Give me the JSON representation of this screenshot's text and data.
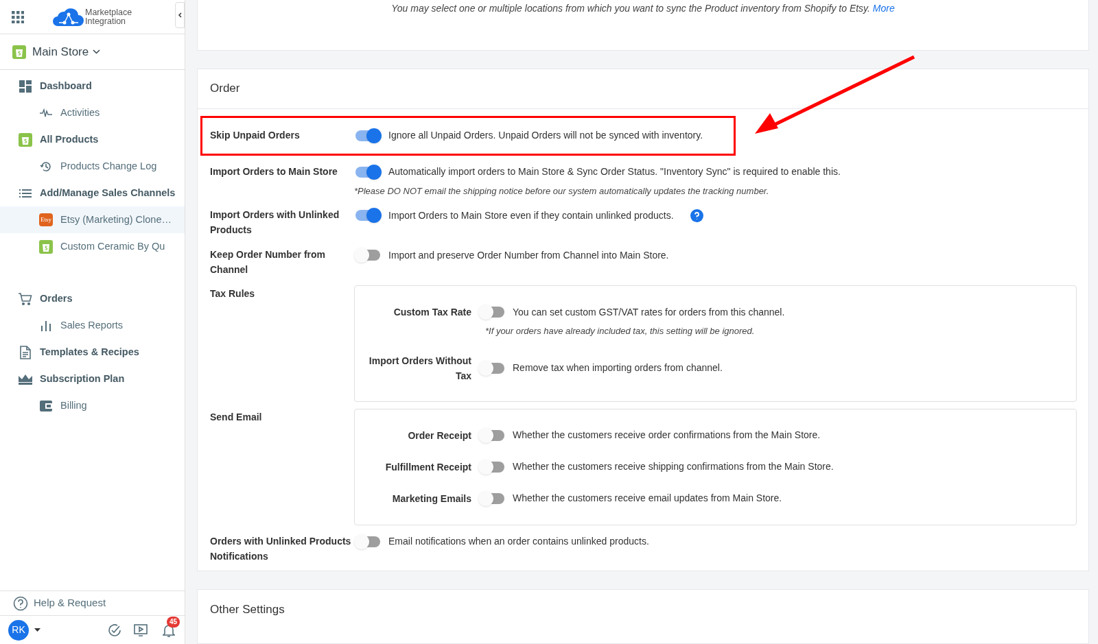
{
  "app": {
    "logo_line1": "Marketplace",
    "logo_line2": "Integration"
  },
  "store": {
    "name": "Main Store"
  },
  "sidebar": {
    "items": [
      {
        "label": "Dashboard",
        "selected": false,
        "children": [
          {
            "label": "Activities",
            "selected": false
          }
        ]
      },
      {
        "label": "All Products",
        "selected": false,
        "children": [
          {
            "label": "Products Change Log",
            "selected": false
          }
        ]
      },
      {
        "label": "Add/Manage Sales Channels",
        "selected": false,
        "children": [
          {
            "label": "Etsy (Marketing) Clone…",
            "selected": true,
            "badge": "Etsy"
          },
          {
            "label": "Custom Ceramic By Qu",
            "selected": false
          }
        ]
      },
      {
        "label": "Orders",
        "selected": false,
        "children": [
          {
            "label": "Sales Reports",
            "selected": false
          }
        ]
      },
      {
        "label": "Templates & Recipes",
        "selected": false
      },
      {
        "label": "Subscription Plan",
        "selected": false,
        "children": [
          {
            "label": "Billing",
            "selected": false
          }
        ]
      }
    ]
  },
  "help": {
    "label": "Help & Request"
  },
  "footer": {
    "avatar": "RK",
    "notifications": "45"
  },
  "intro": {
    "text": "You may select one or multiple locations from which you want to sync the Product inventory from Shopify to Etsy.",
    "link": "More"
  },
  "order": {
    "title": "Order",
    "rows": [
      {
        "kind": "toggle",
        "label": "Skip Unpaid Orders",
        "on": true,
        "highlighted": true,
        "description": "Ignore all Unpaid Orders. Unpaid Orders will not be synced with inventory."
      },
      {
        "kind": "toggle",
        "label": "Import Orders to Main Store",
        "on": true,
        "highlighted": false,
        "description": "Automatically import orders to Main Store & Sync Order Status. \"Inventory Sync\" is required to enable this.",
        "note": "*Please DO NOT email the shipping notice before our system automatically updates the tracking number."
      },
      {
        "kind": "toggle",
        "label": "Import Orders with Unlinked Products",
        "on": true,
        "highlighted": false,
        "description": "Import Orders to Main Store even if they contain unlinked products.",
        "help": true
      },
      {
        "kind": "toggle",
        "label": "Keep Order Number from Channel",
        "on": false,
        "highlighted": false,
        "description": "Import and preserve Order Number from Channel into Main Store."
      },
      {
        "kind": "group",
        "label": "Tax Rules",
        "items": [
          {
            "label": "Custom Tax Rate",
            "on": false,
            "description": "You can set custom GST/VAT rates for orders from this channel.",
            "note": "*If your orders have already included tax, this setting will be ignored."
          },
          {
            "label": "Import Orders Without Tax",
            "on": false,
            "description": "Remove tax when importing orders from channel."
          }
        ]
      },
      {
        "kind": "group",
        "label": "Send Email",
        "items": [
          {
            "label": "Order Receipt",
            "on": false,
            "description": "Whether the customers receive order confirmations from the Main Store."
          },
          {
            "label": "Fulfillment Receipt",
            "on": false,
            "description": "Whether the customers receive shipping confirmations from the Main Store."
          },
          {
            "label": "Marketing Emails",
            "on": false,
            "description": "Whether the customers receive email updates from Main Store."
          }
        ]
      },
      {
        "kind": "toggle",
        "label": "Orders with Unlinked Products Notifications",
        "on": false,
        "highlighted": false,
        "description": "Email notifications when an order contains unlinked products."
      }
    ]
  },
  "other": {
    "title": "Other Settings"
  }
}
